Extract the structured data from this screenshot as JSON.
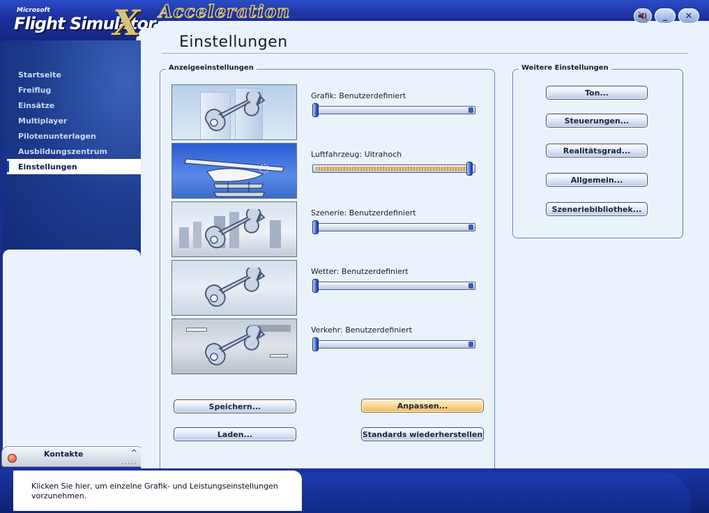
{
  "window": {
    "app_logo_small": "Microsoft",
    "app_logo_main": "Flight Simulator",
    "app_logo_x": "X",
    "edition": "Acceleration",
    "minimize_label": "_",
    "close_label": "✕"
  },
  "sidebar": {
    "items": [
      {
        "label": "Startseite"
      },
      {
        "label": "Freiflug"
      },
      {
        "label": "Einsätze"
      },
      {
        "label": "Multiplayer"
      },
      {
        "label": "Pilotenunterlagen"
      },
      {
        "label": "Ausbildungszentrum"
      },
      {
        "label": "Einstellungen",
        "active": true
      }
    ],
    "contacts_label": "Kontakte",
    "contacts_chevron": "^",
    "contacts_grip": "....."
  },
  "main": {
    "title": "Einstellungen",
    "display_group": {
      "legend": "Anzeigeeinstellungen",
      "sliders": [
        {
          "label": "Grafik: Benutzerdefiniert",
          "value": 0.0
        },
        {
          "label": "Luftfahrzeug: Ultrahoch",
          "value": 1.0
        },
        {
          "label": "Szenerie: Benutzerdefiniert",
          "value": 0.0
        },
        {
          "label": "Wetter: Benutzerdefiniert",
          "value": 0.0
        },
        {
          "label": "Verkehr: Benutzerdefiniert",
          "value": 0.0
        }
      ],
      "buttons": {
        "save": "Speichern...",
        "customize": "Anpassen...",
        "load": "Laden...",
        "restore_defaults": "Standards wiederherstellen"
      }
    },
    "more_group": {
      "legend": "Weitere Einstellungen",
      "buttons": [
        "Ton...",
        "Steuerungen...",
        "Realitätsgrad...",
        "Allgemein...",
        "Szeneriebibliothek..."
      ]
    }
  },
  "tip": {
    "text": "Klicken Sie hier, um einzelne Grafik- und Leistungseinstellungen vorzunehmen."
  },
  "colors": {
    "accent_blue": "#1a2f9a",
    "panel_bg": "#eaf3fb",
    "highlight_orange": "#fcd890"
  }
}
